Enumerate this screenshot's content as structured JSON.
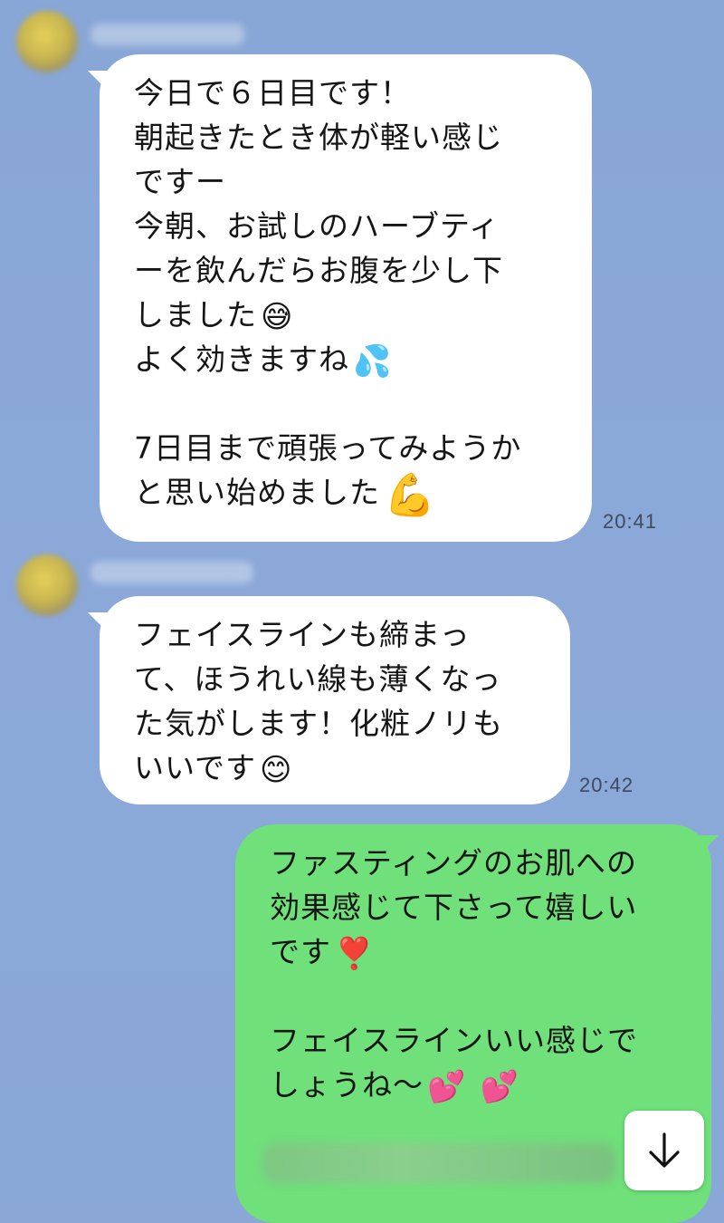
{
  "messages": [
    {
      "direction": "incoming",
      "lines": [
        "今日で６日目です！",
        "朝起きたとき体が軽い感じ",
        "ですー",
        "今朝、お試しのハーブティ",
        "ーを飲んだらお腹を少し下",
        "しました",
        "よく効きますね",
        "",
        "7日目まで頑張ってみようか",
        "と思い始めました"
      ],
      "emojis": [
        "😅",
        "💦",
        "💪"
      ],
      "time": "20:41"
    },
    {
      "direction": "incoming",
      "lines": [
        "フェイスラインも締まっ",
        "て、ほうれい線も薄くなっ",
        "た気がします！化粧ノリも",
        "いいです"
      ],
      "emojis": [
        "😊"
      ],
      "time": "20:42"
    },
    {
      "direction": "outgoing",
      "lines": [
        "ファスティングのお肌への",
        "効果感じて下さって嬉しい",
        "です",
        "",
        "フェイスラインいい感じで",
        "しょうね〜"
      ],
      "emojis": [
        "❣️",
        "💕",
        "💕"
      ]
    }
  ],
  "colors": {
    "background": "#8aa7d6",
    "incoming_bubble": "#ffffff",
    "outgoing_bubble": "#6fe07a",
    "timestamp": "#3f4a5e"
  },
  "icons": {
    "scroll_down": "arrow-down-icon"
  }
}
